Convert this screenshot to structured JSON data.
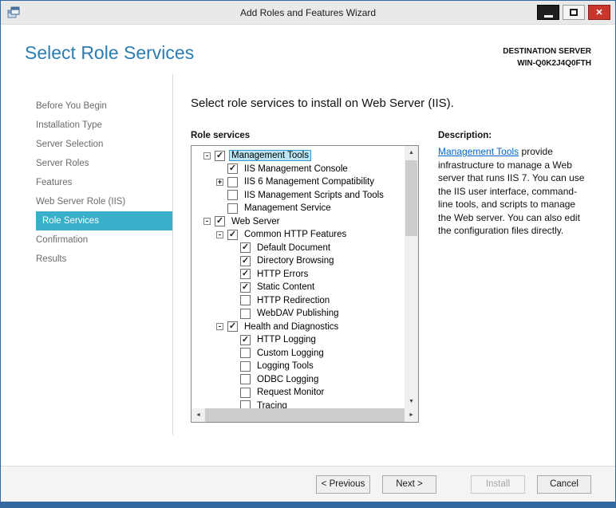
{
  "window": {
    "title": "Add Roles and Features Wizard"
  },
  "header": {
    "title": "Select Role Services",
    "destination_label": "DESTINATION SERVER",
    "destination_server": "WIN-Q0K2J4Q0FTH"
  },
  "sidebar": {
    "items": [
      {
        "label": "Before You Begin",
        "active": false
      },
      {
        "label": "Installation Type",
        "active": false
      },
      {
        "label": "Server Selection",
        "active": false
      },
      {
        "label": "Server Roles",
        "active": false
      },
      {
        "label": "Features",
        "active": false
      },
      {
        "label": "Web Server Role (IIS)",
        "active": false
      },
      {
        "label": "Role Services",
        "active": true
      },
      {
        "label": "Confirmation",
        "active": false
      },
      {
        "label": "Results",
        "active": false
      }
    ]
  },
  "main": {
    "instruction": "Select role services to install on Web Server (IIS).",
    "tree_label": "Role services",
    "tree": [
      {
        "label": "Management Tools",
        "level": 0,
        "checked": true,
        "expander": "minus",
        "focused": true
      },
      {
        "label": "IIS Management Console",
        "level": 1,
        "checked": true,
        "expander": "none",
        "focused": false
      },
      {
        "label": "IIS 6 Management Compatibility",
        "level": 1,
        "checked": false,
        "expander": "plus",
        "focused": false
      },
      {
        "label": "IIS Management Scripts and Tools",
        "level": 1,
        "checked": false,
        "expander": "none",
        "focused": false
      },
      {
        "label": "Management Service",
        "level": 1,
        "checked": false,
        "expander": "none",
        "focused": false
      },
      {
        "label": "Web Server",
        "level": 0,
        "checked": true,
        "expander": "minus",
        "focused": false
      },
      {
        "label": "Common HTTP Features",
        "level": 1,
        "checked": true,
        "expander": "minus",
        "focused": false
      },
      {
        "label": "Default Document",
        "level": 2,
        "checked": true,
        "expander": "none",
        "focused": false
      },
      {
        "label": "Directory Browsing",
        "level": 2,
        "checked": true,
        "expander": "none",
        "focused": false
      },
      {
        "label": "HTTP Errors",
        "level": 2,
        "checked": true,
        "expander": "none",
        "focused": false
      },
      {
        "label": "Static Content",
        "level": 2,
        "checked": true,
        "expander": "none",
        "focused": false
      },
      {
        "label": "HTTP Redirection",
        "level": 2,
        "checked": false,
        "expander": "none",
        "focused": false
      },
      {
        "label": "WebDAV Publishing",
        "level": 2,
        "checked": false,
        "expander": "none",
        "focused": false
      },
      {
        "label": "Health and Diagnostics",
        "level": 1,
        "checked": true,
        "expander": "minus",
        "focused": false
      },
      {
        "label": "HTTP Logging",
        "level": 2,
        "checked": true,
        "expander": "none",
        "focused": false
      },
      {
        "label": "Custom Logging",
        "level": 2,
        "checked": false,
        "expander": "none",
        "focused": false
      },
      {
        "label": "Logging Tools",
        "level": 2,
        "checked": false,
        "expander": "none",
        "focused": false
      },
      {
        "label": "ODBC Logging",
        "level": 2,
        "checked": false,
        "expander": "none",
        "focused": false
      },
      {
        "label": "Request Monitor",
        "level": 2,
        "checked": false,
        "expander": "none",
        "focused": false
      },
      {
        "label": "Tracing",
        "level": 2,
        "checked": false,
        "expander": "none",
        "focused": false
      }
    ]
  },
  "description": {
    "heading": "Description:",
    "link_text": "Management Tools",
    "text_after": " provide infrastructure to manage a Web server that runs IIS 7. You can use the IIS user interface, command-line tools, and scripts to manage the Web server. You can also edit the configuration files directly."
  },
  "footer": {
    "previous": "< Previous",
    "next": "Next >",
    "install": "Install",
    "cancel": "Cancel"
  },
  "icons": {
    "close_glyph": "✕",
    "check_glyph": "✓",
    "collapse_glyph": "-",
    "expand_glyph": "+",
    "scroll_up_glyph": "▲",
    "scroll_down_glyph": "▼",
    "scroll_left_glyph": "◄",
    "scroll_right_glyph": "►"
  },
  "colors": {
    "window_border": "#30689f",
    "titlebar_bg": "#e9e9e9",
    "close_button": "#c9372c",
    "heading_blue": "#2b7cb0",
    "nav_selected_teal": "#3aafc9",
    "link_blue": "#0066cc",
    "tree_focus_bg": "#bde6f5",
    "tree_focus_border": "#3699d2"
  }
}
